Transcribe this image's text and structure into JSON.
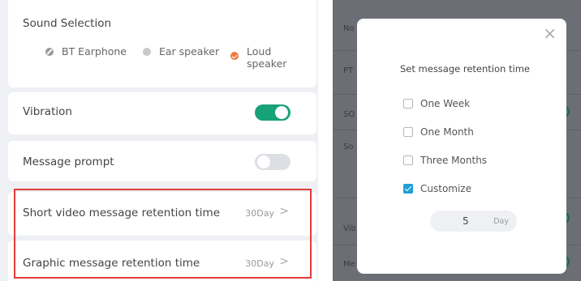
{
  "left": {
    "sound": {
      "title": "Sound Selection",
      "options": [
        {
          "label": "BT Earphone",
          "icon": "bt-off-icon"
        },
        {
          "label": "Ear speaker",
          "icon": "radio-unselected-icon"
        },
        {
          "label_line1": "Loud",
          "label_line2": "speaker",
          "icon": "radio-selected-icon",
          "selected": true
        }
      ]
    },
    "vibration": {
      "label": "Vibration",
      "on": true
    },
    "prompt": {
      "label": "Message prompt",
      "on": false
    },
    "short_video": {
      "label": "Short video message retention time",
      "value": "30Day",
      "chevron": ">"
    },
    "graphic": {
      "label": "Graphic message retention time",
      "value": "30Day",
      "chevron": ">"
    }
  },
  "right": {
    "background_labels": [
      "No",
      "PT",
      "SO",
      "So",
      "Vib",
      "Me"
    ],
    "dialog": {
      "close": "×",
      "title": "Set message retention time",
      "options": [
        {
          "label": "One Week",
          "checked": false
        },
        {
          "label": "One Month",
          "checked": false
        },
        {
          "label": "Three Months",
          "checked": false
        },
        {
          "label": "Customize",
          "checked": true
        }
      ],
      "custom_value": "5",
      "custom_unit": "Day"
    }
  },
  "colors": {
    "toggle_on": "#18a278",
    "highlight": "#e23b3b",
    "checkbox_checked": "#1e9fd6",
    "loud_radio": "#f07a3a",
    "overlay": "#6b6e74"
  }
}
